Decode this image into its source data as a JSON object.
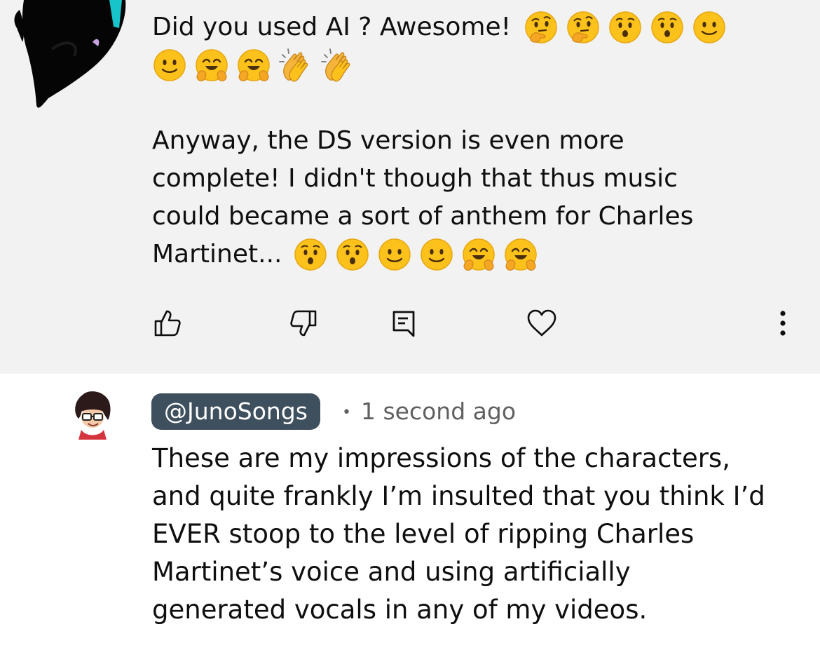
{
  "top_comment": {
    "line1_text": "Did you used AI ? Awesome!",
    "line1_emojis": [
      "thinking-face-emoji",
      "thinking-face-emoji",
      "hushed-face-emoji",
      "hushed-face-emoji",
      "slight-smile-emoji"
    ],
    "line2_emojis": [
      "slight-smile-emoji",
      "hugging-face-emoji",
      "hugging-face-emoji",
      "clapping-hands-emoji",
      "clapping-hands-emoji"
    ],
    "paragraph_lines": [
      "Anyway, the DS version is even more",
      "complete! I didn't though that thus music",
      "could became a sort of anthem for Charles",
      "Martinet..."
    ],
    "last_line_emojis": [
      "hushed-face-emoji",
      "hushed-face-emoji",
      "slight-smile-emoji",
      "slight-smile-emoji",
      "hugging-face-emoji",
      "hugging-face-emoji"
    ]
  },
  "actions": {
    "like_icon": "thumbs-up-icon",
    "dislike_icon": "thumbs-down-icon",
    "reply_icon": "reply-comment-icon",
    "heart_icon": "heart-icon",
    "more_icon": "more-vertical-icon"
  },
  "reply": {
    "handle": "@JunoSongs",
    "separator": "•",
    "timestamp": "1 second ago",
    "lines": [
      "These are my impressions of the characters,",
      "and quite frankly I’m insulted that you think I’d",
      "EVER stoop to the level of ripping Charles",
      "Martinet’s voice and using artificially",
      "generated vocals in any of my videos."
    ]
  },
  "colors": {
    "top_background": "#f2f2f2",
    "handle_pill": "#3e4f5e",
    "meta_text": "#606060",
    "text": "#0f0f0f"
  }
}
